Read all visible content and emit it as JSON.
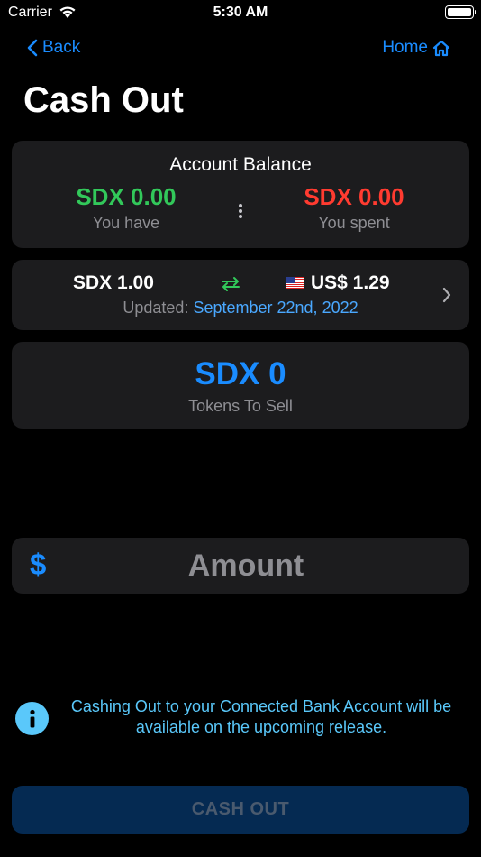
{
  "status_bar": {
    "carrier": "Carrier",
    "time": "5:30 AM",
    "icons": [
      "wifi-icon",
      "battery-icon"
    ]
  },
  "nav": {
    "back_label": "Back",
    "home_label": "Home",
    "accent_color": "#1a8cff"
  },
  "page": {
    "title": "Cash Out"
  },
  "balance": {
    "title": "Account Balance",
    "have_amount": "SDX 0.00",
    "have_label": "You have",
    "spent_amount": "SDX 0.00",
    "spent_label": "You spent",
    "have_color": "#32c85a",
    "spent_color": "#ff3b30"
  },
  "rate": {
    "sdx_value": "SDX 1.00",
    "usd_value": "US$ 1.29",
    "updated_label": "Updated:",
    "updated_date": "September 22nd, 2022"
  },
  "tokens": {
    "value": "SDX 0",
    "label": "Tokens To Sell"
  },
  "amount": {
    "currency_symbol": "$",
    "placeholder": "Amount",
    "value": ""
  },
  "info": {
    "message": "Cashing Out to your Connected Bank Account will be available on the upcoming release."
  },
  "actions": {
    "cash_out_label": "CASH OUT",
    "cash_out_enabled": false
  }
}
